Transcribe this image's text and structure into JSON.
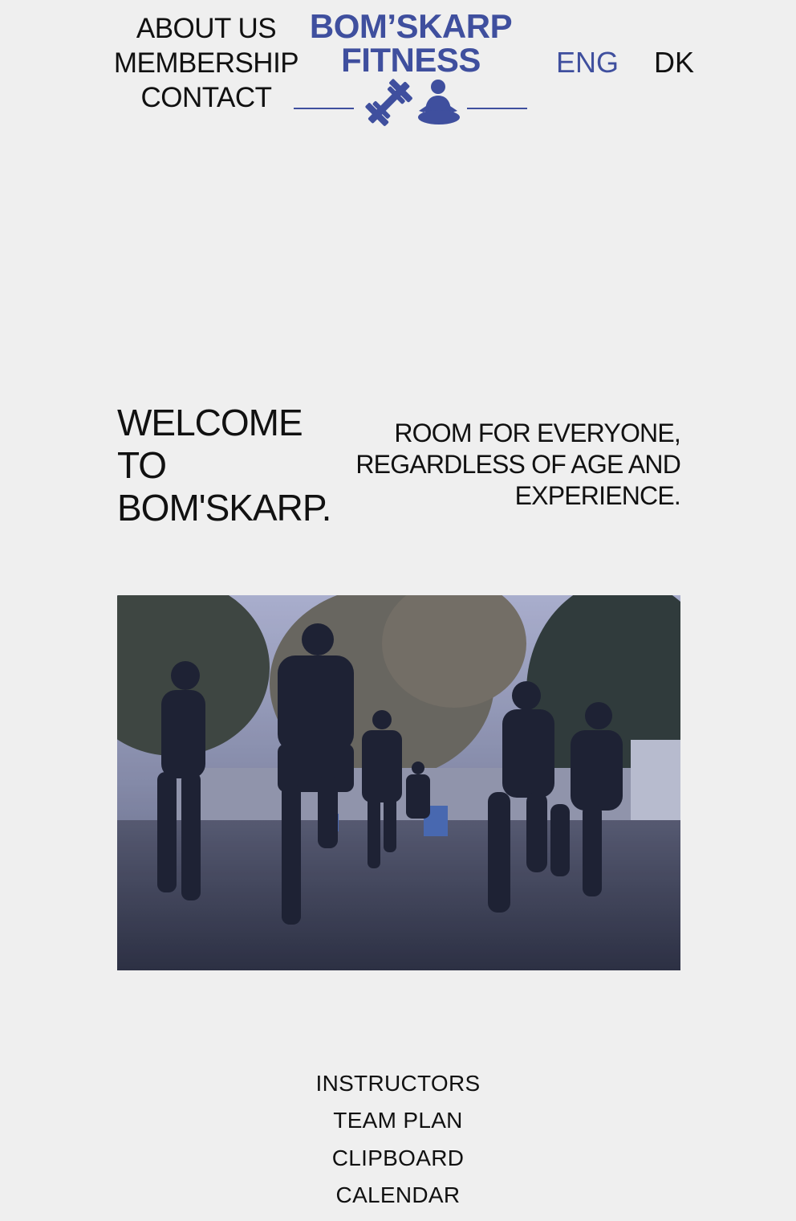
{
  "nav": {
    "items": [
      "ABOUT US",
      "MEMBERSHIP",
      "CONTACT"
    ]
  },
  "logo": {
    "line1": "BOM’SKARP",
    "line2": "FITNESS",
    "icons": [
      "dumbbell-icon",
      "meditation-icon"
    ]
  },
  "language": {
    "options": [
      "ENG",
      "DK"
    ],
    "selected": "ENG"
  },
  "hero": {
    "heading": "WELCOME TO BOM'SKARP.",
    "heading_lines": [
      "WELCOME",
      "TO",
      "BOM'SKARP."
    ],
    "tagline_lines": [
      "ROOM FOR EVERYONE,",
      "REGARDLESS OF AGE AND",
      "EXPERIENCE."
    ]
  },
  "footer_nav": {
    "items": [
      "INSTRUCTORS",
      "TEAM PLAN",
      "CLIPBOARD",
      "CALENDAR"
    ]
  },
  "colors": {
    "brand": "#3f4f9e",
    "background": "#efefef",
    "text": "#111111"
  }
}
